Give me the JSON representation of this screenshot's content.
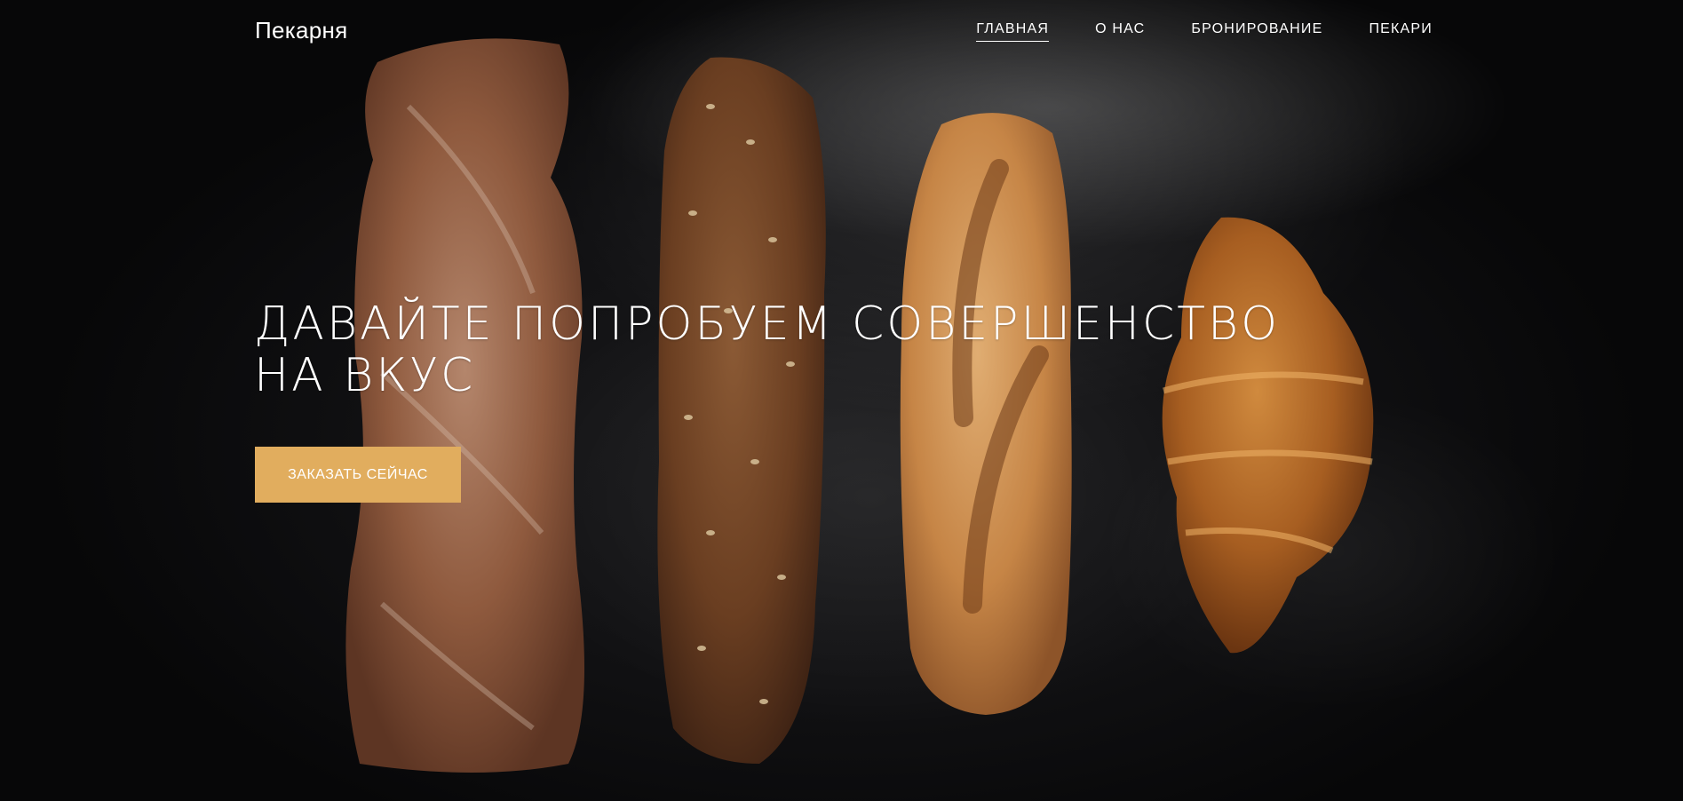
{
  "header": {
    "logo": "Пекарня",
    "nav": [
      {
        "label": "ГЛАВНАЯ",
        "active": true
      },
      {
        "label": "О НАС",
        "active": false
      },
      {
        "label": "БРОНИРОВАНИЕ",
        "active": false
      },
      {
        "label": "ПЕКАРИ",
        "active": false
      }
    ]
  },
  "hero": {
    "headline": "Давайте попробуем совершенство на вкус",
    "cta_label": "ЗАКАЗАТЬ СЕЙЧАС",
    "background_image": "bread-on-dark-flour-photo"
  },
  "colors": {
    "accent": "#e1ad5e",
    "background": "#111113",
    "text": "#ffffff"
  }
}
